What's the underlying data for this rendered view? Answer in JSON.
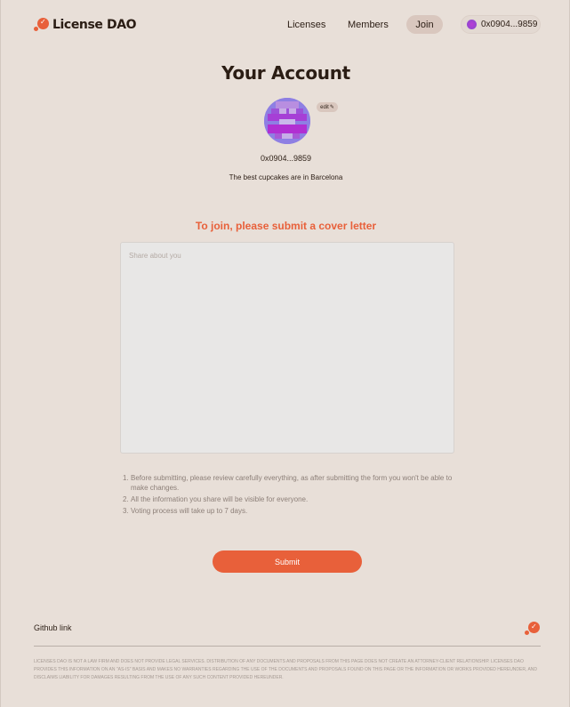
{
  "header": {
    "logo_text": "License DAO",
    "nav": {
      "licenses": "Licenses",
      "members": "Members",
      "join": "Join"
    },
    "wallet_address": "0x0904...9859"
  },
  "account": {
    "title": "Your Account",
    "edit_label": "edit",
    "address": "0x0904...9859",
    "bio": "The best cupcakes are in Barcelona"
  },
  "join_form": {
    "heading": "To join, please submit a cover letter",
    "cover_letter_value": "",
    "cover_letter_placeholder": "Share about you",
    "rules": [
      "Before submitting, please review carefully everything, as after submitting the form you won't be able to make changes.",
      "All the information you share will be visible for everyone.",
      "Voting process will take up to 7 days."
    ],
    "submit_label": "Submit"
  },
  "footer": {
    "github_link": "Github link",
    "disclaimer": "LICENSES DAO IS NOT A LAW FIRM AND DOES NOT PROVIDE LEGAL SERVICES. DISTRIBUTION OF ANY DOCUMENTS AND PROPOSALS FROM THIS PAGE DOES NOT CREATE AN ATTORNEY-CLIENT RELATIONSHIP. LICENSES DAO PROVIDES THIS INFORMATION ON AN \"AS-IS\" BASIS AND MAKES NO WARRANTIES REGARDING THE USE OF THE DOCUMENTS AND PROPOSALS FOUND ON THIS PAGE OR THE INFORMATION OR WORKS PROVIDED HEREUNDER, AND DISCLAIMS LIABILITY FOR DAMAGES RESULTING FROM THE USE OF ANY SUCH CONTENT PROVIDED HEREUNDER."
  },
  "icons": {
    "logo": "license-dao-logo-icon",
    "edit": "pencil-icon",
    "wallet_avatar": "wallet-avatar-icon"
  },
  "colors": {
    "background": "#e8dfd8",
    "accent": "#e8603a",
    "pill": "#d9c7be",
    "text": "#2b1d14"
  }
}
